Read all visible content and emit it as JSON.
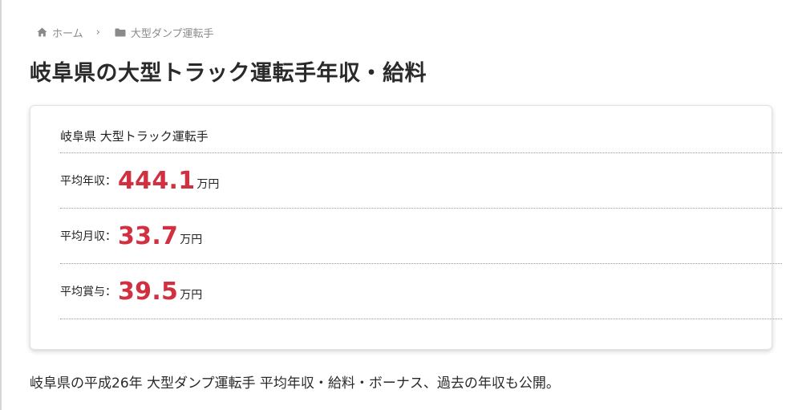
{
  "breadcrumb": {
    "home_label": "ホーム",
    "separator": "›",
    "category_label": "大型ダンプ運転手"
  },
  "page": {
    "title": "岐阜県の大型トラック運転手年収・給料"
  },
  "salary_card": {
    "heading": "岐阜県 大型トラック運転手",
    "stats": [
      {
        "label": "平均年収：",
        "value": "444.1",
        "unit": "万円"
      },
      {
        "label": "平均月収：",
        "value": "33.7",
        "unit": "万円"
      },
      {
        "label": "平均賞与：",
        "value": "39.5",
        "unit": "万円"
      }
    ]
  },
  "intro": {
    "text": "岐阜県の平成26年 大型ダンプ運転手 平均年収・給料・ボーナス、過去の年収も公開。"
  },
  "colors": {
    "accent_value": "#d0303f",
    "breadcrumb_text": "#8a8a8a"
  }
}
